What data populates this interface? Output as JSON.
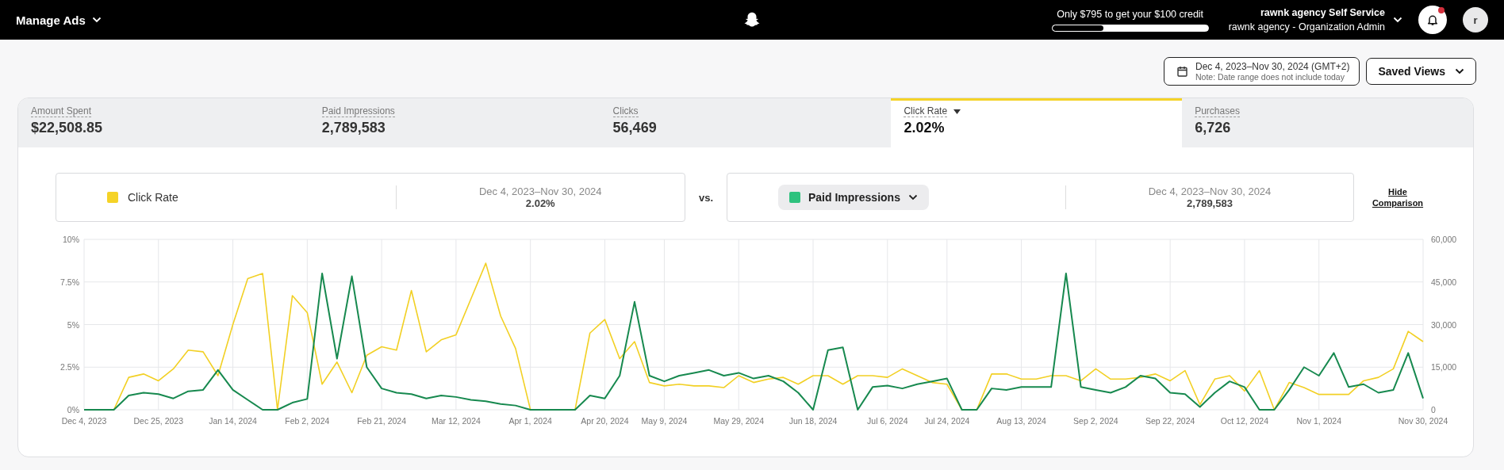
{
  "top_bar": {
    "menu": "Manage Ads",
    "credit": {
      "text": "Only $795 to get your $100 credit",
      "level": 0.33
    },
    "account": {
      "name": "rawnk agency Self Service",
      "role": "rawnk agency - Organization Admin"
    },
    "notifications": {
      "unread": true
    },
    "avatar": "r"
  },
  "toolbar": {
    "date_range": {
      "range": "Dec 4, 2023–Nov 30, 2024 (GMT+2)",
      "note": "Note: Date range does not include today"
    },
    "saved_views": "Saved Views"
  },
  "metrics": [
    {
      "label": "Amount Spent",
      "value": "$22,508.85",
      "selected": false
    },
    {
      "label": "Paid Impressions",
      "value": "2,789,583",
      "selected": false
    },
    {
      "label": "Clicks",
      "value": "56,469",
      "selected": false
    },
    {
      "label": "Click Rate",
      "value": "2.02%",
      "selected": true
    },
    {
      "label": "Purchases",
      "value": "6,726",
      "selected": false
    }
  ],
  "comparison": {
    "primary": {
      "color": "#f5d327",
      "range": "Dec 4, 2023–Nov 30, 2024",
      "value": "2.02%"
    },
    "separator": "vs.",
    "secondary": {
      "color": "#2ec27e",
      "range": "Dec 4, 2023–Nov 30, 2024",
      "value": "2,789,583"
    },
    "hide_link": "Hide Comparison"
  },
  "chart_data": {
    "type": "line",
    "grid": true,
    "categories": [
      "Dec 4, 2023",
      null,
      null,
      null,
      null,
      "Dec 25, 2023",
      null,
      null,
      null,
      null,
      "Jan 14, 2024",
      null,
      null,
      null,
      null,
      "Feb 2, 2024",
      null,
      null,
      null,
      null,
      "Feb 21, 2024",
      null,
      null,
      null,
      null,
      "Mar 12, 2024",
      null,
      null,
      null,
      null,
      "Apr 1, 2024",
      null,
      null,
      null,
      null,
      "Apr 20, 2024",
      null,
      null,
      null,
      "May 9, 2024",
      null,
      null,
      null,
      null,
      "May 29, 2024",
      null,
      null,
      null,
      null,
      "Jun 18, 2024",
      null,
      null,
      null,
      null,
      "Jul 6, 2024",
      null,
      null,
      null,
      "Jul 24, 2024",
      null,
      null,
      null,
      null,
      "Aug 13, 2024",
      null,
      null,
      null,
      null,
      "Sep 2, 2024",
      null,
      null,
      null,
      null,
      "Sep 22, 2024",
      null,
      null,
      null,
      null,
      "Oct 12, 2024",
      null,
      null,
      null,
      null,
      "Nov 1, 2024",
      null,
      null,
      null,
      null,
      null,
      null,
      "Nov 30, 2024"
    ],
    "ylim": [
      0,
      10
    ],
    "yticks": [
      {
        "value": 0,
        "label": "0%"
      },
      {
        "value": 2.5,
        "label": "2.5%"
      },
      {
        "value": 5,
        "label": "5%"
      },
      {
        "value": 7.5,
        "label": "7.5%"
      },
      {
        "value": 10,
        "label": "10%"
      }
    ],
    "y2lim": [
      0,
      60000
    ],
    "y2ticks": [
      {
        "value": 0,
        "label": "0"
      },
      {
        "value": 15000,
        "label": "15,000"
      },
      {
        "value": 30000,
        "label": "30,000"
      },
      {
        "value": 45000,
        "label": "45,000"
      },
      {
        "value": 60000,
        "label": "60,000"
      }
    ],
    "series": [
      {
        "name": "Click Rate",
        "color": "#f2d024",
        "values": [
          0,
          0,
          0,
          1.9,
          2.1,
          1.7,
          2.4,
          3.5,
          3.4,
          2.0,
          5.0,
          7.7,
          8.0,
          0,
          6.7,
          5.7,
          1.5,
          2.8,
          1.0,
          3.2,
          3.7,
          3.5,
          7.0,
          3.4,
          4.1,
          4.4,
          6.5,
          8.6,
          5.5,
          3.6,
          0,
          0,
          0,
          0,
          4.5,
          5.3,
          3.0,
          4.0,
          1.6,
          1.4,
          1.5,
          1.4,
          1.4,
          1.3,
          2.0,
          1.6,
          1.8,
          1.9,
          1.5,
          2.0,
          2.0,
          1.5,
          2.0,
          2.0,
          1.9,
          2.4,
          2.0,
          1.6,
          1.5,
          0,
          0,
          2.1,
          2.1,
          1.8,
          1.8,
          2.0,
          2.0,
          1.7,
          2.4,
          1.8,
          1.8,
          1.9,
          2.1,
          1.7,
          2.3,
          0.3,
          1.8,
          2.0,
          1.1,
          2.3,
          0,
          1.6,
          1.3,
          0.9,
          0.9,
          0.9,
          1.7,
          1.9,
          2.4,
          4.6,
          4.0
        ]
      },
      {
        "name": "Paid Impressions",
        "color": "#17894f",
        "axis": "y2",
        "values": [
          0,
          0,
          0,
          5000,
          6000,
          5500,
          4000,
          6500,
          7000,
          14000,
          7000,
          3500,
          0,
          0,
          2500,
          3800,
          48000,
          18000,
          47000,
          15000,
          7500,
          6000,
          5500,
          4000,
          5000,
          4500,
          3500,
          3000,
          2000,
          1500,
          0,
          0,
          0,
          0,
          5000,
          4000,
          12000,
          38000,
          12000,
          10000,
          12000,
          13000,
          14000,
          12000,
          13000,
          11000,
          12000,
          10000,
          6000,
          0,
          21000,
          22000,
          0,
          8000,
          8500,
          7500,
          9000,
          10000,
          11000,
          0,
          0,
          7500,
          7000,
          8000,
          8000,
          8000,
          48000,
          8000,
          7000,
          6000,
          8000,
          12000,
          11000,
          6000,
          5500,
          1000,
          6000,
          10000,
          8000,
          0,
          0,
          7000,
          15000,
          12000,
          20000,
          8000,
          9000,
          6000,
          7000,
          20000,
          4000
        ]
      }
    ]
  }
}
